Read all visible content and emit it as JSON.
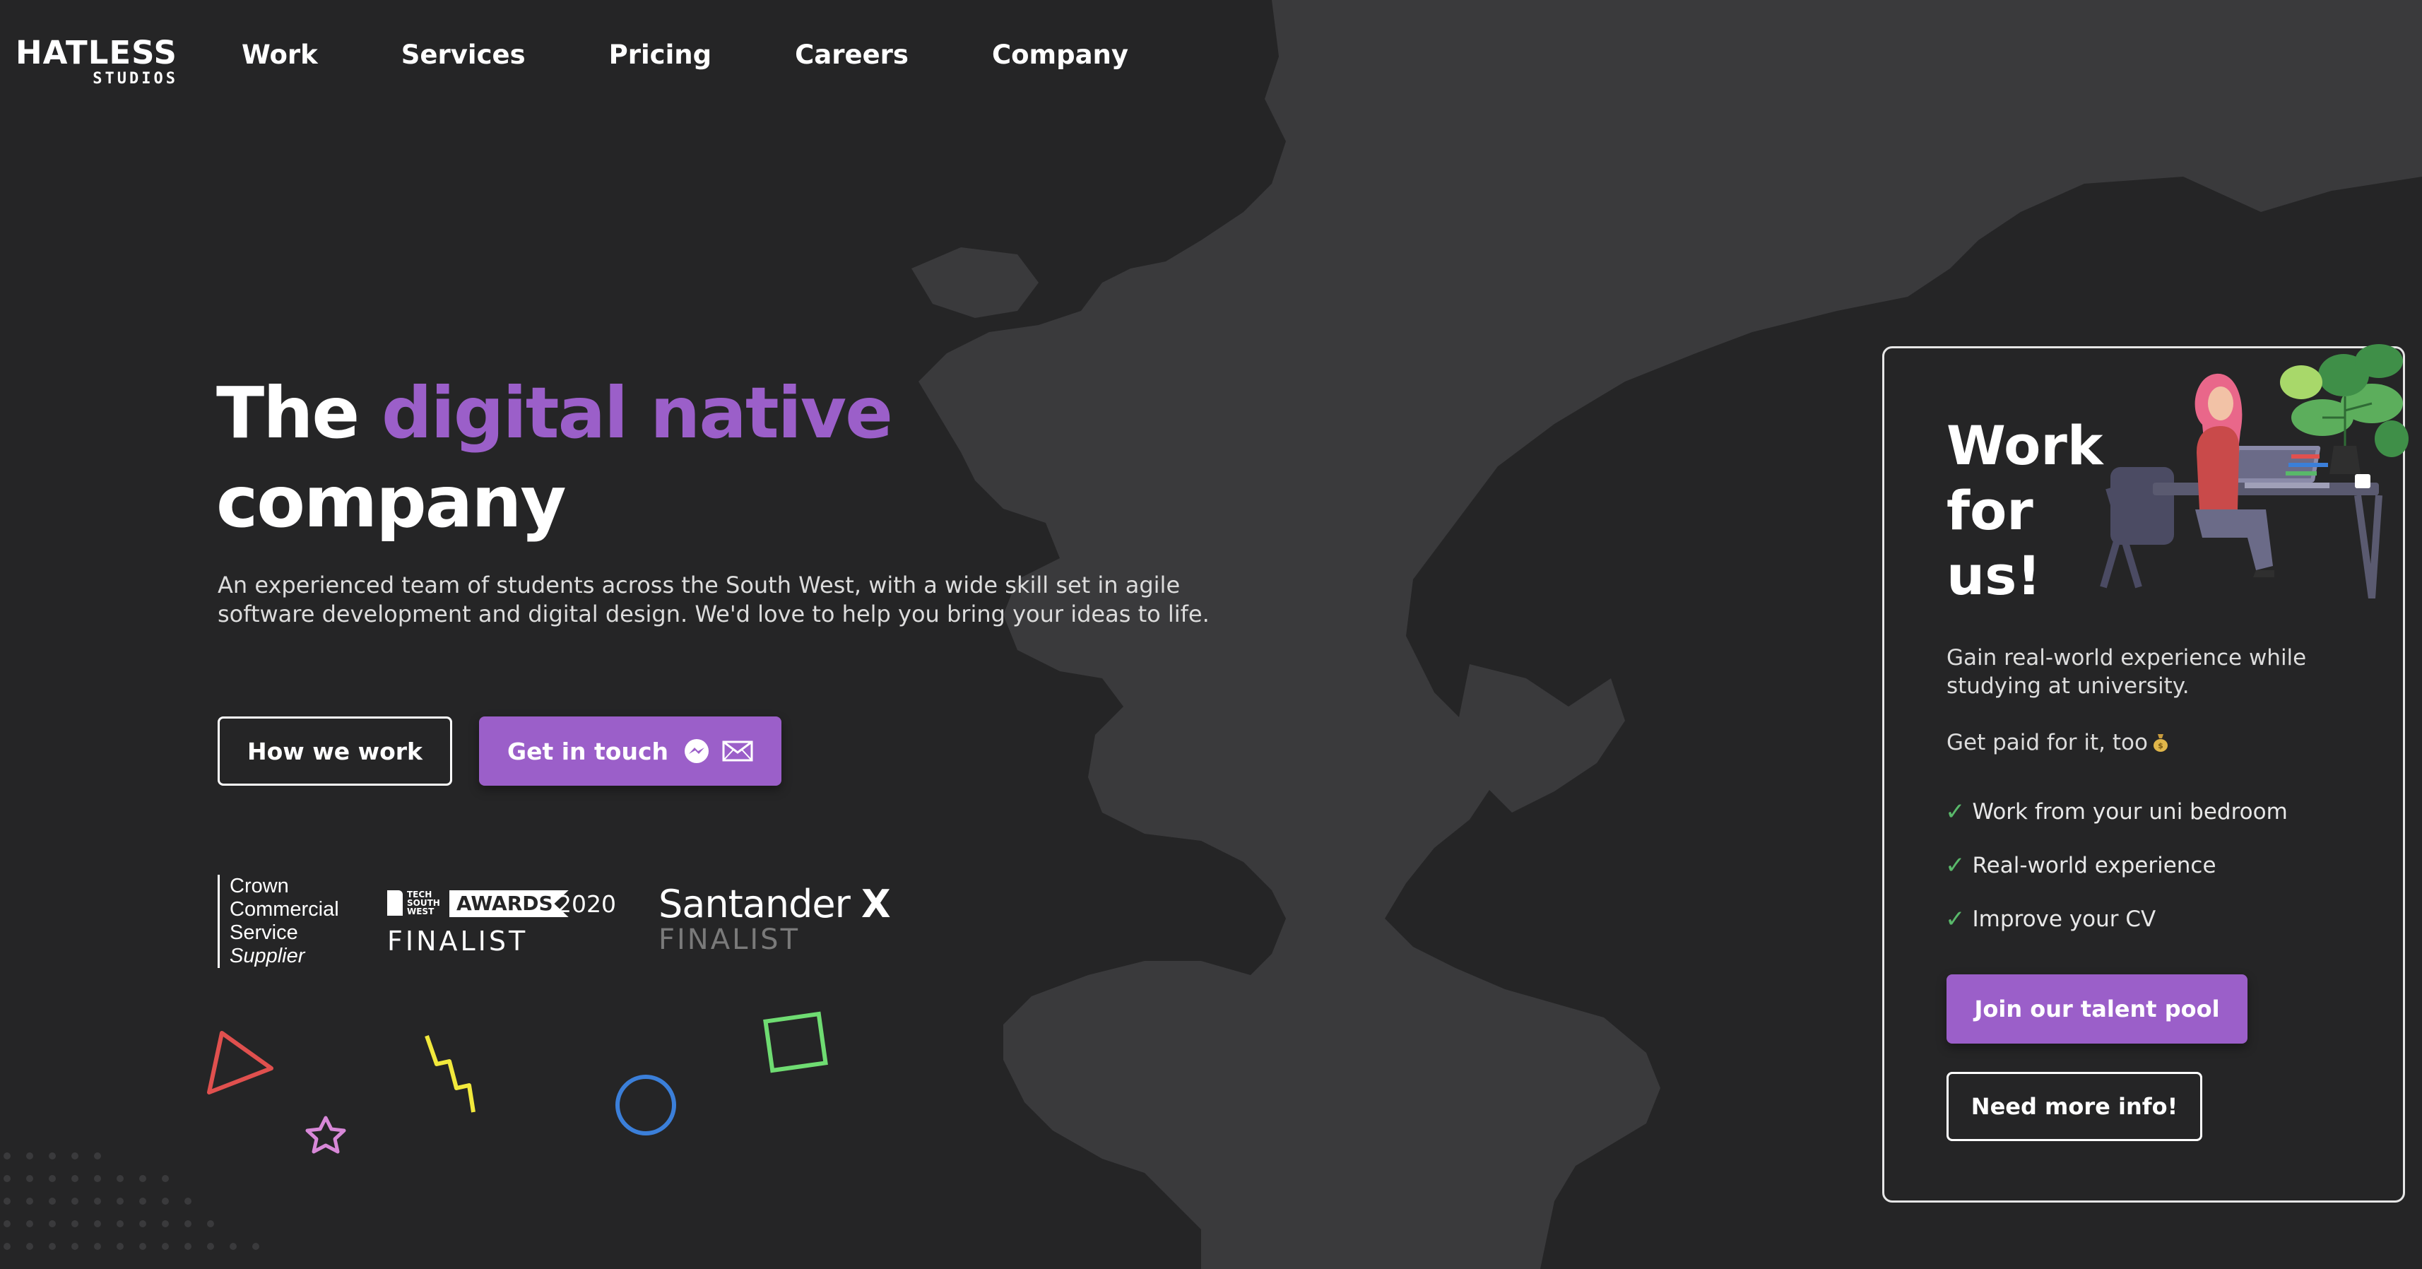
{
  "brand": {
    "logo_main": "HATLESS",
    "logo_sub": "STUDIOS"
  },
  "nav": {
    "items": [
      "Work",
      "Services",
      "Pricing",
      "Careers",
      "Company"
    ]
  },
  "hero": {
    "title_part1": "The ",
    "title_accent": "digital native",
    "title_part2": "company",
    "description": "An experienced team of students across the South West, with a wide skill set in agile software development and digital design. We'd love to help you bring your ideas to life.",
    "buttons": {
      "how_we_work": "How we work",
      "get_in_touch": "Get in touch"
    }
  },
  "awards": {
    "ccs": [
      "Crown",
      "Commercial",
      "Service",
      "Supplier"
    ],
    "tsw": {
      "small": [
        "TECH",
        "SOUTH",
        "WEST"
      ],
      "tag": "AWARDS",
      "year": "2020",
      "finalist": "FINALIST"
    },
    "santander": {
      "name": "Santander",
      "x": "X",
      "finalist": "FINALIST"
    }
  },
  "career_card": {
    "title": "Work for us!",
    "subtitle": "Gain real-world experience while studying at university.",
    "paid": "Get paid for it, too",
    "perks": [
      "Work from your uni bedroom",
      "Real-world experience",
      "Improve your CV"
    ],
    "check_mark": "✓",
    "buttons": {
      "join": "Join our talent pool",
      "info": "Need more info!"
    }
  },
  "colors": {
    "background": "#252526",
    "map_land": "#3a3a3c",
    "accent": "#9b5fc9",
    "check": "#59b86a",
    "text": "#ffffff"
  },
  "icons": [
    "messenger-icon",
    "email-icon",
    "money-bag-icon"
  ]
}
